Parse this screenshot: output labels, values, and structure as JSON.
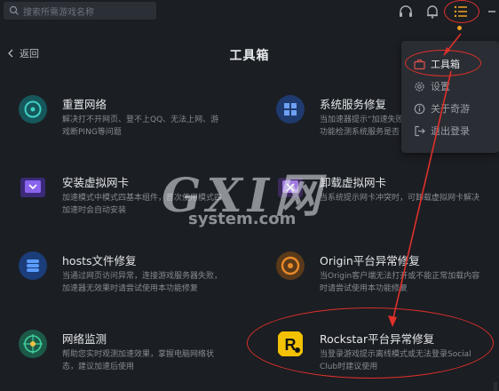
{
  "search": {
    "placeholder": "搜索所需游戏名称"
  },
  "header": {
    "back_label": "返回",
    "title": "工具箱"
  },
  "menu": {
    "items": [
      {
        "label": "工具箱",
        "icon": "toolbox-icon",
        "active": true
      },
      {
        "label": "设置",
        "icon": "gear-icon",
        "active": false
      },
      {
        "label": "关于奇游",
        "icon": "info-icon",
        "active": false
      },
      {
        "label": "退出登录",
        "icon": "logout-icon",
        "active": false
      }
    ]
  },
  "tools": [
    {
      "name": "重置网络",
      "desc": "解决打不开网页、登不上QQ、无法上网、游\n戏断PING等问题",
      "icon": "reset-network-icon"
    },
    {
      "name": "系统服务修复",
      "desc": "当加速器提示“加速失败”时，可使用此\n功能检测系统服务是否",
      "icon": "windows-service-icon"
    },
    {
      "name": "安装虚拟网卡",
      "desc": "加速模式中模式四基本组件，首次使用模式四\n加速时会自动安装",
      "icon": "install-nic-icon"
    },
    {
      "name": "卸载虚拟网卡",
      "desc": "当系统提示网卡冲突时，可卸载虚拟网卡解决",
      "icon": "uninstall-nic-icon"
    },
    {
      "name": "hosts文件修复",
      "desc": "当通过网页访问异常，连接游戏服务器失败，\n加速器无效果时请尝试使用本功能修复",
      "icon": "hosts-repair-icon"
    },
    {
      "name": "Origin平台异常修复",
      "desc": "当Origin客户端无法打开或不能正常加载内容\n时请尝试使用本功能修复",
      "icon": "origin-icon"
    },
    {
      "name": "网络监测",
      "desc": "帮助您实时观测加速效果，掌握电脑网络状\n态，建议加速后使用",
      "icon": "network-monitor-icon"
    },
    {
      "name": "Rockstar平台异常修复",
      "desc": "当登录游戏提示离线模式或无法登录Social\nClub时建议使用",
      "icon": "rockstar-icon"
    }
  ],
  "watermark": {
    "main": "GXI网",
    "sub": "system.com"
  },
  "colors": {
    "background": "#1b1e23",
    "accent": "#e0302a",
    "highlight_dot": "#f0a020",
    "icon_teal": "#1f9c94",
    "icon_blue": "#3a6ed6",
    "icon_purple": "#7a4fd8"
  }
}
